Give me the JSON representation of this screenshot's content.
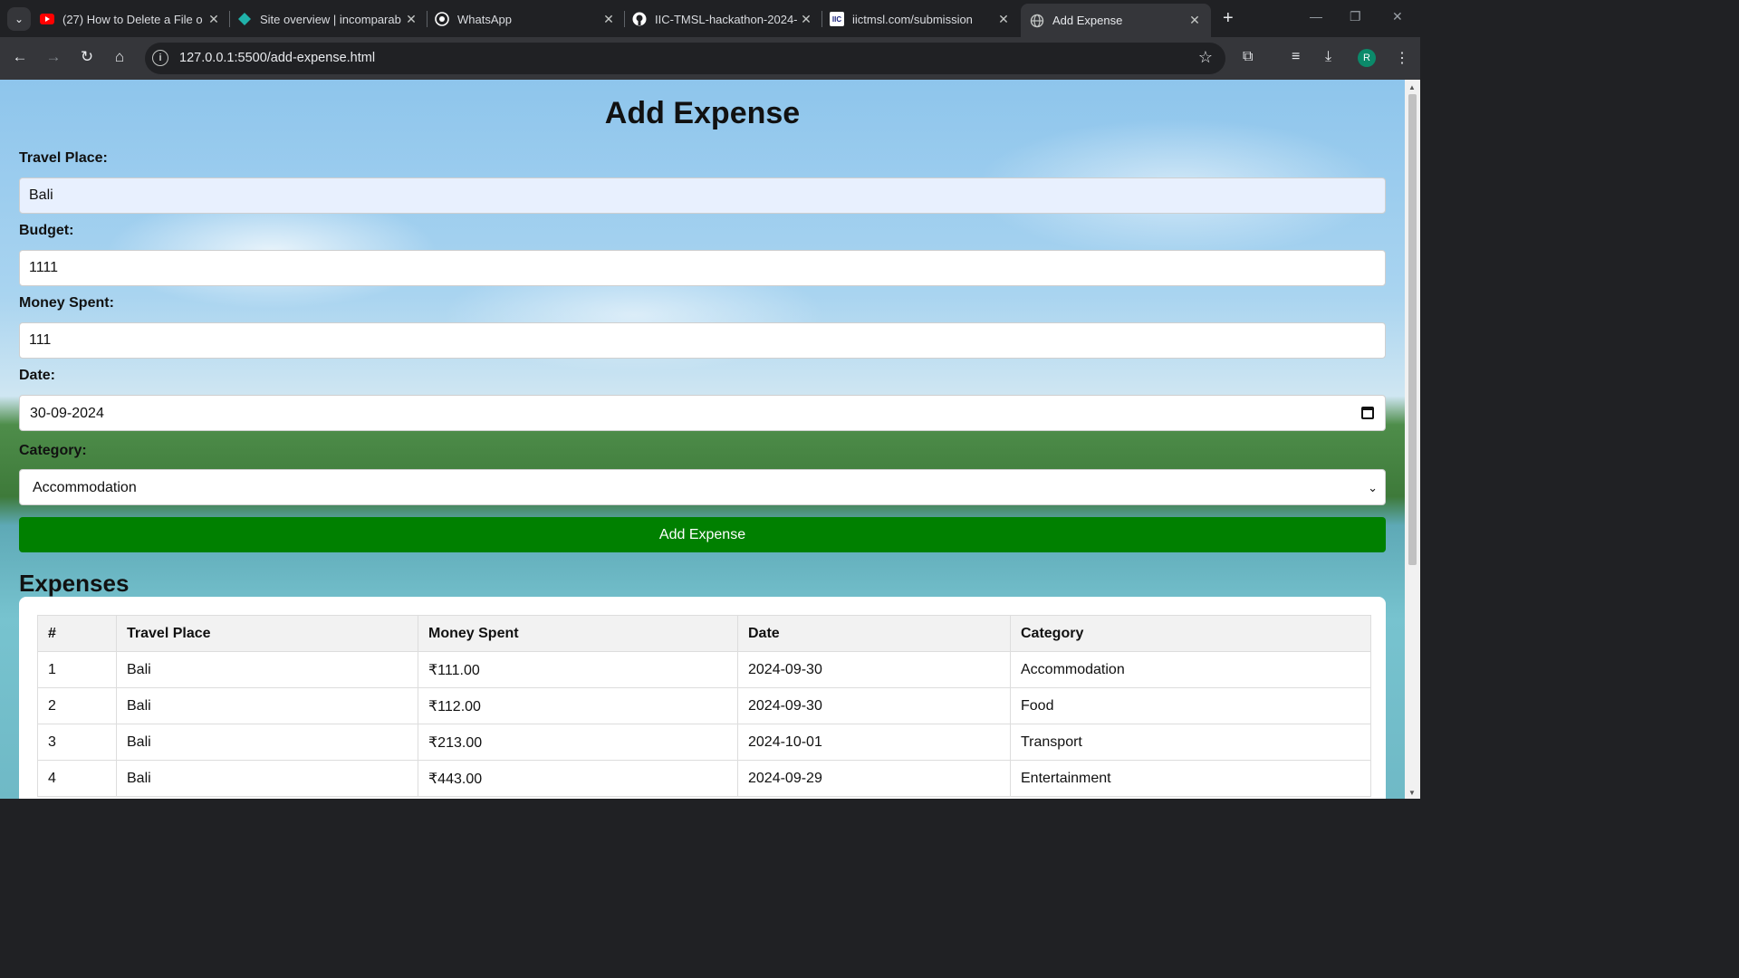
{
  "browser": {
    "tabs": [
      {
        "title": "(27) How to Delete a File o",
        "icon": "youtube-icon",
        "active": false
      },
      {
        "title": "Site overview | incomparab",
        "icon": "diamond-icon",
        "active": false
      },
      {
        "title": "WhatsApp",
        "icon": "whatsapp-icon",
        "active": false
      },
      {
        "title": "IIC-TMSL-hackathon-2024-",
        "icon": "github-icon",
        "active": false
      },
      {
        "title": "iictmsl.com/submission",
        "icon": "iic-icon",
        "active": false
      },
      {
        "title": "Add Expense",
        "icon": "globe-icon",
        "active": true
      }
    ],
    "url": "127.0.0.1:5500/add-expense.html",
    "profile_initial": "R",
    "iic_badge": "IIC"
  },
  "form": {
    "title": "Add Expense",
    "travel_place": {
      "label": "Travel Place:",
      "value": "Bali"
    },
    "budget": {
      "label": "Budget:",
      "value": "1111"
    },
    "money_spent": {
      "label": "Money Spent:",
      "value": "111"
    },
    "date": {
      "label": "Date:",
      "value": "30-09-2024"
    },
    "category": {
      "label": "Category:",
      "value": "Accommodation"
    },
    "submit_label": "Add Expense"
  },
  "expenses": {
    "title": "Expenses",
    "columns": [
      "#",
      "Travel Place",
      "Money Spent",
      "Date",
      "Category"
    ],
    "rows": [
      [
        "1",
        "Bali",
        "₹111.00",
        "2024-09-30",
        "Accommodation"
      ],
      [
        "2",
        "Bali",
        "₹112.00",
        "2024-09-30",
        "Food"
      ],
      [
        "3",
        "Bali",
        "₹213.00",
        "2024-10-01",
        "Transport"
      ],
      [
        "4",
        "Bali",
        "₹443.00",
        "2024-09-29",
        "Entertainment"
      ]
    ]
  },
  "colors": {
    "submit_button": "#008000",
    "autofill": "#e8f0fe"
  }
}
